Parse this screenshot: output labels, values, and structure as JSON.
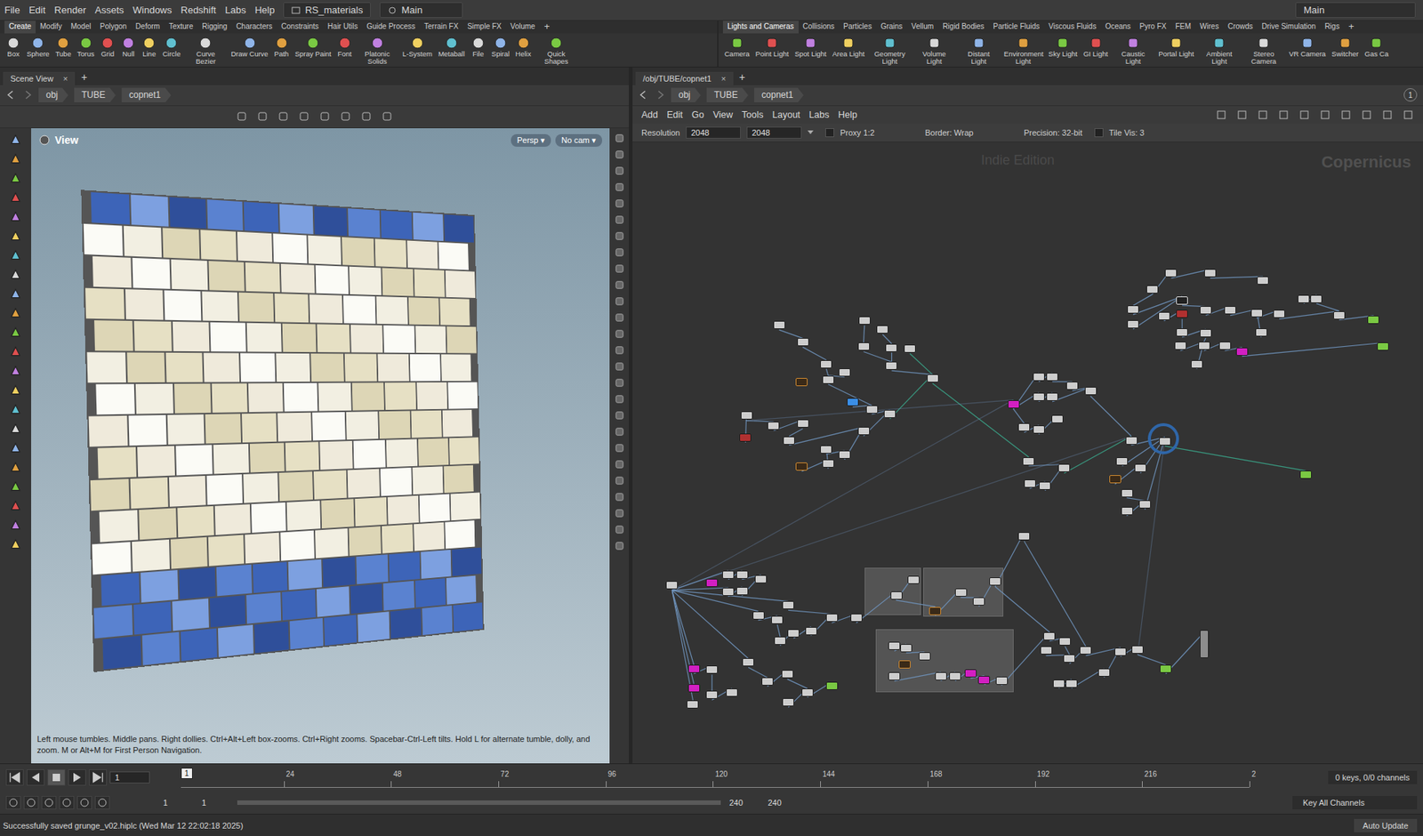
{
  "window": {
    "title": "Houdini"
  },
  "menubar": {
    "items": [
      "File",
      "Edit",
      "Render",
      "Assets",
      "Windows",
      "Redshift",
      "Labs",
      "Help"
    ],
    "desktop": "RS_materials",
    "context": "Main",
    "right_context": "Main"
  },
  "shelf_left": {
    "tabs": [
      {
        "label": "Create",
        "selected": true
      },
      {
        "label": "Modify",
        "selected": false
      },
      {
        "label": "Model",
        "selected": false
      },
      {
        "label": "Polygon",
        "selected": false
      },
      {
        "label": "Deform",
        "selected": false
      },
      {
        "label": "Texture",
        "selected": false
      },
      {
        "label": "Rigging",
        "selected": false
      },
      {
        "label": "Characters",
        "selected": false
      },
      {
        "label": "Constraints",
        "selected": false
      },
      {
        "label": "Hair Utils",
        "selected": false
      },
      {
        "label": "Guide Process",
        "selected": false
      },
      {
        "label": "Terrain FX",
        "selected": false
      },
      {
        "label": "Simple FX",
        "selected": false
      },
      {
        "label": "Volume",
        "selected": false
      }
    ],
    "add": "+",
    "tools": [
      "Box",
      "Sphere",
      "Tube",
      "Torus",
      "Grid",
      "Null",
      "Line",
      "Circle",
      "Curve Bezier",
      "Draw Curve",
      "Path",
      "Spray Paint",
      "Font",
      "Platonic Solids",
      "L-System",
      "Metaball",
      "File",
      "Spiral",
      "Helix",
      "Quick Shapes"
    ]
  },
  "shelf_right": {
    "tabs": [
      {
        "label": "Lights and Cameras",
        "selected": true
      },
      {
        "label": "Collisions",
        "selected": false
      },
      {
        "label": "Particles",
        "selected": false
      },
      {
        "label": "Grains",
        "selected": false
      },
      {
        "label": "Vellum",
        "selected": false
      },
      {
        "label": "Rigid Bodies",
        "selected": false
      },
      {
        "label": "Particle Fluids",
        "selected": false
      },
      {
        "label": "Viscous Fluids",
        "selected": false
      },
      {
        "label": "Oceans",
        "selected": false
      },
      {
        "label": "Pyro FX",
        "selected": false
      },
      {
        "label": "FEM",
        "selected": false
      },
      {
        "label": "Wires",
        "selected": false
      },
      {
        "label": "Crowds",
        "selected": false
      },
      {
        "label": "Drive Simulation",
        "selected": false
      },
      {
        "label": "Rigs",
        "selected": false
      }
    ],
    "add": "+",
    "tools": [
      "Camera",
      "Point Light",
      "Spot Light",
      "Area Light",
      "Geometry Light",
      "Volume Light",
      "Distant Light",
      "Environment Light",
      "Sky Light",
      "GI Light",
      "Caustic Light",
      "Portal Light",
      "Ambient Light",
      "Stereo Camera",
      "VR Camera",
      "Switcher",
      "Gas Ca"
    ]
  },
  "scene_view": {
    "tab": "Scene View",
    "close": "×",
    "add": "+",
    "path": [
      "obj",
      "TUBE",
      "copnet1"
    ],
    "view_label": "View",
    "persp": "Persp ▾",
    "cam": "No cam ▾",
    "hint": "Left mouse tumbles. Middle pans. Right dollies. Ctrl+Alt+Left box-zooms. Ctrl+Right zooms. Spacebar-Ctrl-Left tilts. Hold L for alternate tumble, dolly, and zoom. M or Alt+M for First Person Navigation."
  },
  "network": {
    "tab": "/obj/TUBE/copnet1",
    "close": "×",
    "add": "+",
    "path": [
      "obj",
      "TUBE",
      "copnet1"
    ],
    "page": "1",
    "menu": [
      "Add",
      "Edit",
      "Go",
      "View",
      "Tools",
      "Layout",
      "Labs",
      "Help"
    ],
    "resolution_label": "Resolution",
    "resolution": [
      "2048",
      "2048"
    ],
    "proxy": "Proxy 1:2",
    "proxy_checked": false,
    "border": "Border: Wrap",
    "precision": "Precision: 32-bit",
    "tile_vis": "Tile Vis: 3",
    "tile_vis_checked": false,
    "watermark": "Indie Edition",
    "context_label": "Copernicus"
  },
  "timeline": {
    "current_frame": "1",
    "start": 1,
    "end": 240,
    "ticks": [
      {
        "label": "24",
        "frame": 24
      },
      {
        "label": "48",
        "frame": 48
      },
      {
        "label": "72",
        "frame": 72
      },
      {
        "label": "96",
        "frame": 96
      },
      {
        "label": "120",
        "frame": 120
      },
      {
        "label": "144",
        "frame": 144
      },
      {
        "label": "168",
        "frame": 168
      },
      {
        "label": "192",
        "frame": 192
      },
      {
        "label": "216",
        "frame": 216
      },
      {
        "label": "2",
        "frame": 240
      }
    ],
    "keys": "0 keys, 0/0 channels",
    "key_mode": "Key All Channels",
    "range_start": [
      "1",
      "1"
    ],
    "range_end": [
      "240",
      "240"
    ]
  },
  "status": {
    "message": "Successfully saved grunge_v02.hiplc (Wed Mar 12 22:02:18 2025)",
    "auto_update": "Auto Update"
  }
}
